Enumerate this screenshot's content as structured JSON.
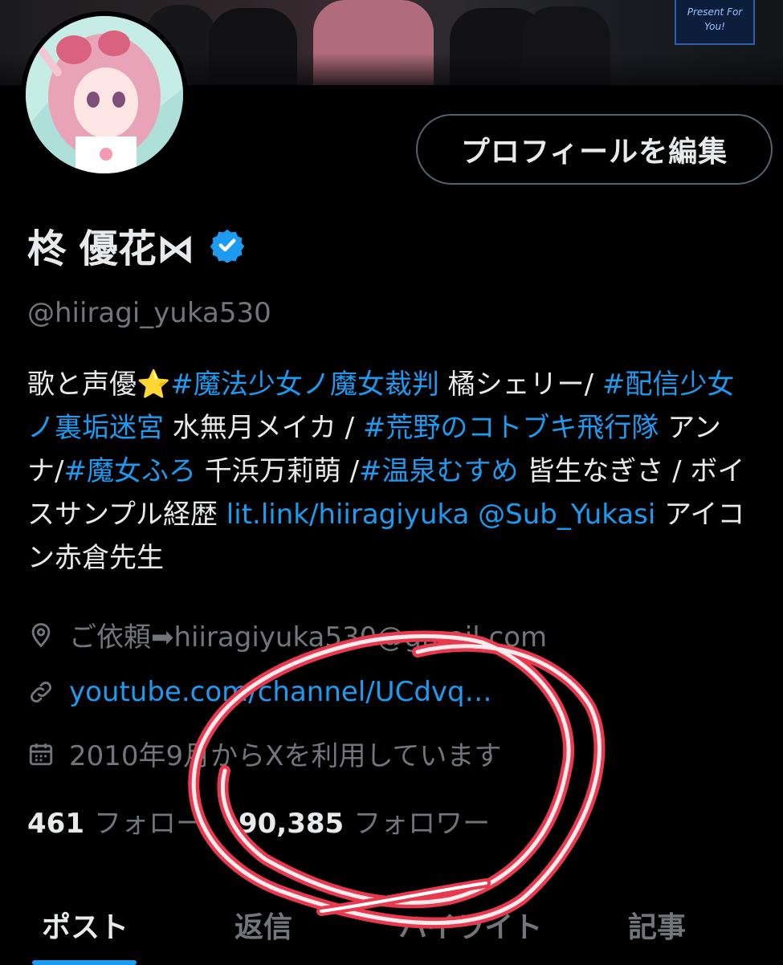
{
  "profile": {
    "display_name": "柊 優花⋈",
    "handle": "@hiiragi_yuka530",
    "edit_button_label": "プロフィールを編集",
    "verified_icon": "verified-badge-icon"
  },
  "bio": {
    "segments": [
      {
        "text": "歌と声優",
        "link": false
      },
      {
        "text": "⭐",
        "link": false
      },
      {
        "text": "#魔法少女ノ魔女裁判",
        "link": true
      },
      {
        "text": " 橘シェリー/ ",
        "link": false
      },
      {
        "text": "#配信少女ノ裏垢迷宮",
        "link": true
      },
      {
        "text": " 水無月メイカ / ",
        "link": false
      },
      {
        "text": "#荒野のコトブキ飛行隊",
        "link": true
      },
      {
        "text": " アンナ/",
        "link": false
      },
      {
        "text": "#魔女ふろ",
        "link": true
      },
      {
        "text": " 千浜万莉萌 /",
        "link": false
      },
      {
        "text": "#温泉むすめ",
        "link": true
      },
      {
        "text": " 皆生なぎさ / ボイスサンプル経歴 ",
        "link": false
      },
      {
        "text": "lit.link/hiiragiyuka",
        "link": true
      },
      {
        "text": " ",
        "link": false
      },
      {
        "text": "@Sub_Yukasi",
        "link": true
      },
      {
        "text": " アイコン赤倉先生",
        "link": false
      }
    ]
  },
  "meta": {
    "location_icon": "location-pin-icon",
    "location_text": "ご依頼➡hiiragiyuka530@gmail.com",
    "link_icon": "link-icon",
    "link_text": "youtube.com/channel/UCdvq…",
    "calendar_icon": "calendar-icon",
    "joined_text": "2010年9月からXを利用しています"
  },
  "stats": {
    "following_count": "461",
    "following_label": "フォロー",
    "followers_count": "90,385",
    "followers_label": "フォロワー"
  },
  "tabs": [
    {
      "label": "ポスト",
      "active": true
    },
    {
      "label": "返信",
      "active": false
    },
    {
      "label": "ハイライト",
      "active": false
    },
    {
      "label": "記事",
      "active": false
    }
  ],
  "banner": {
    "sign_text": "Present For You!"
  },
  "colors": {
    "background": "#000000",
    "text_primary": "#e7e9ea",
    "text_secondary": "#71767b",
    "link": "#1d9bf0",
    "border": "#536471",
    "annotation_circle": "#e8394f"
  }
}
